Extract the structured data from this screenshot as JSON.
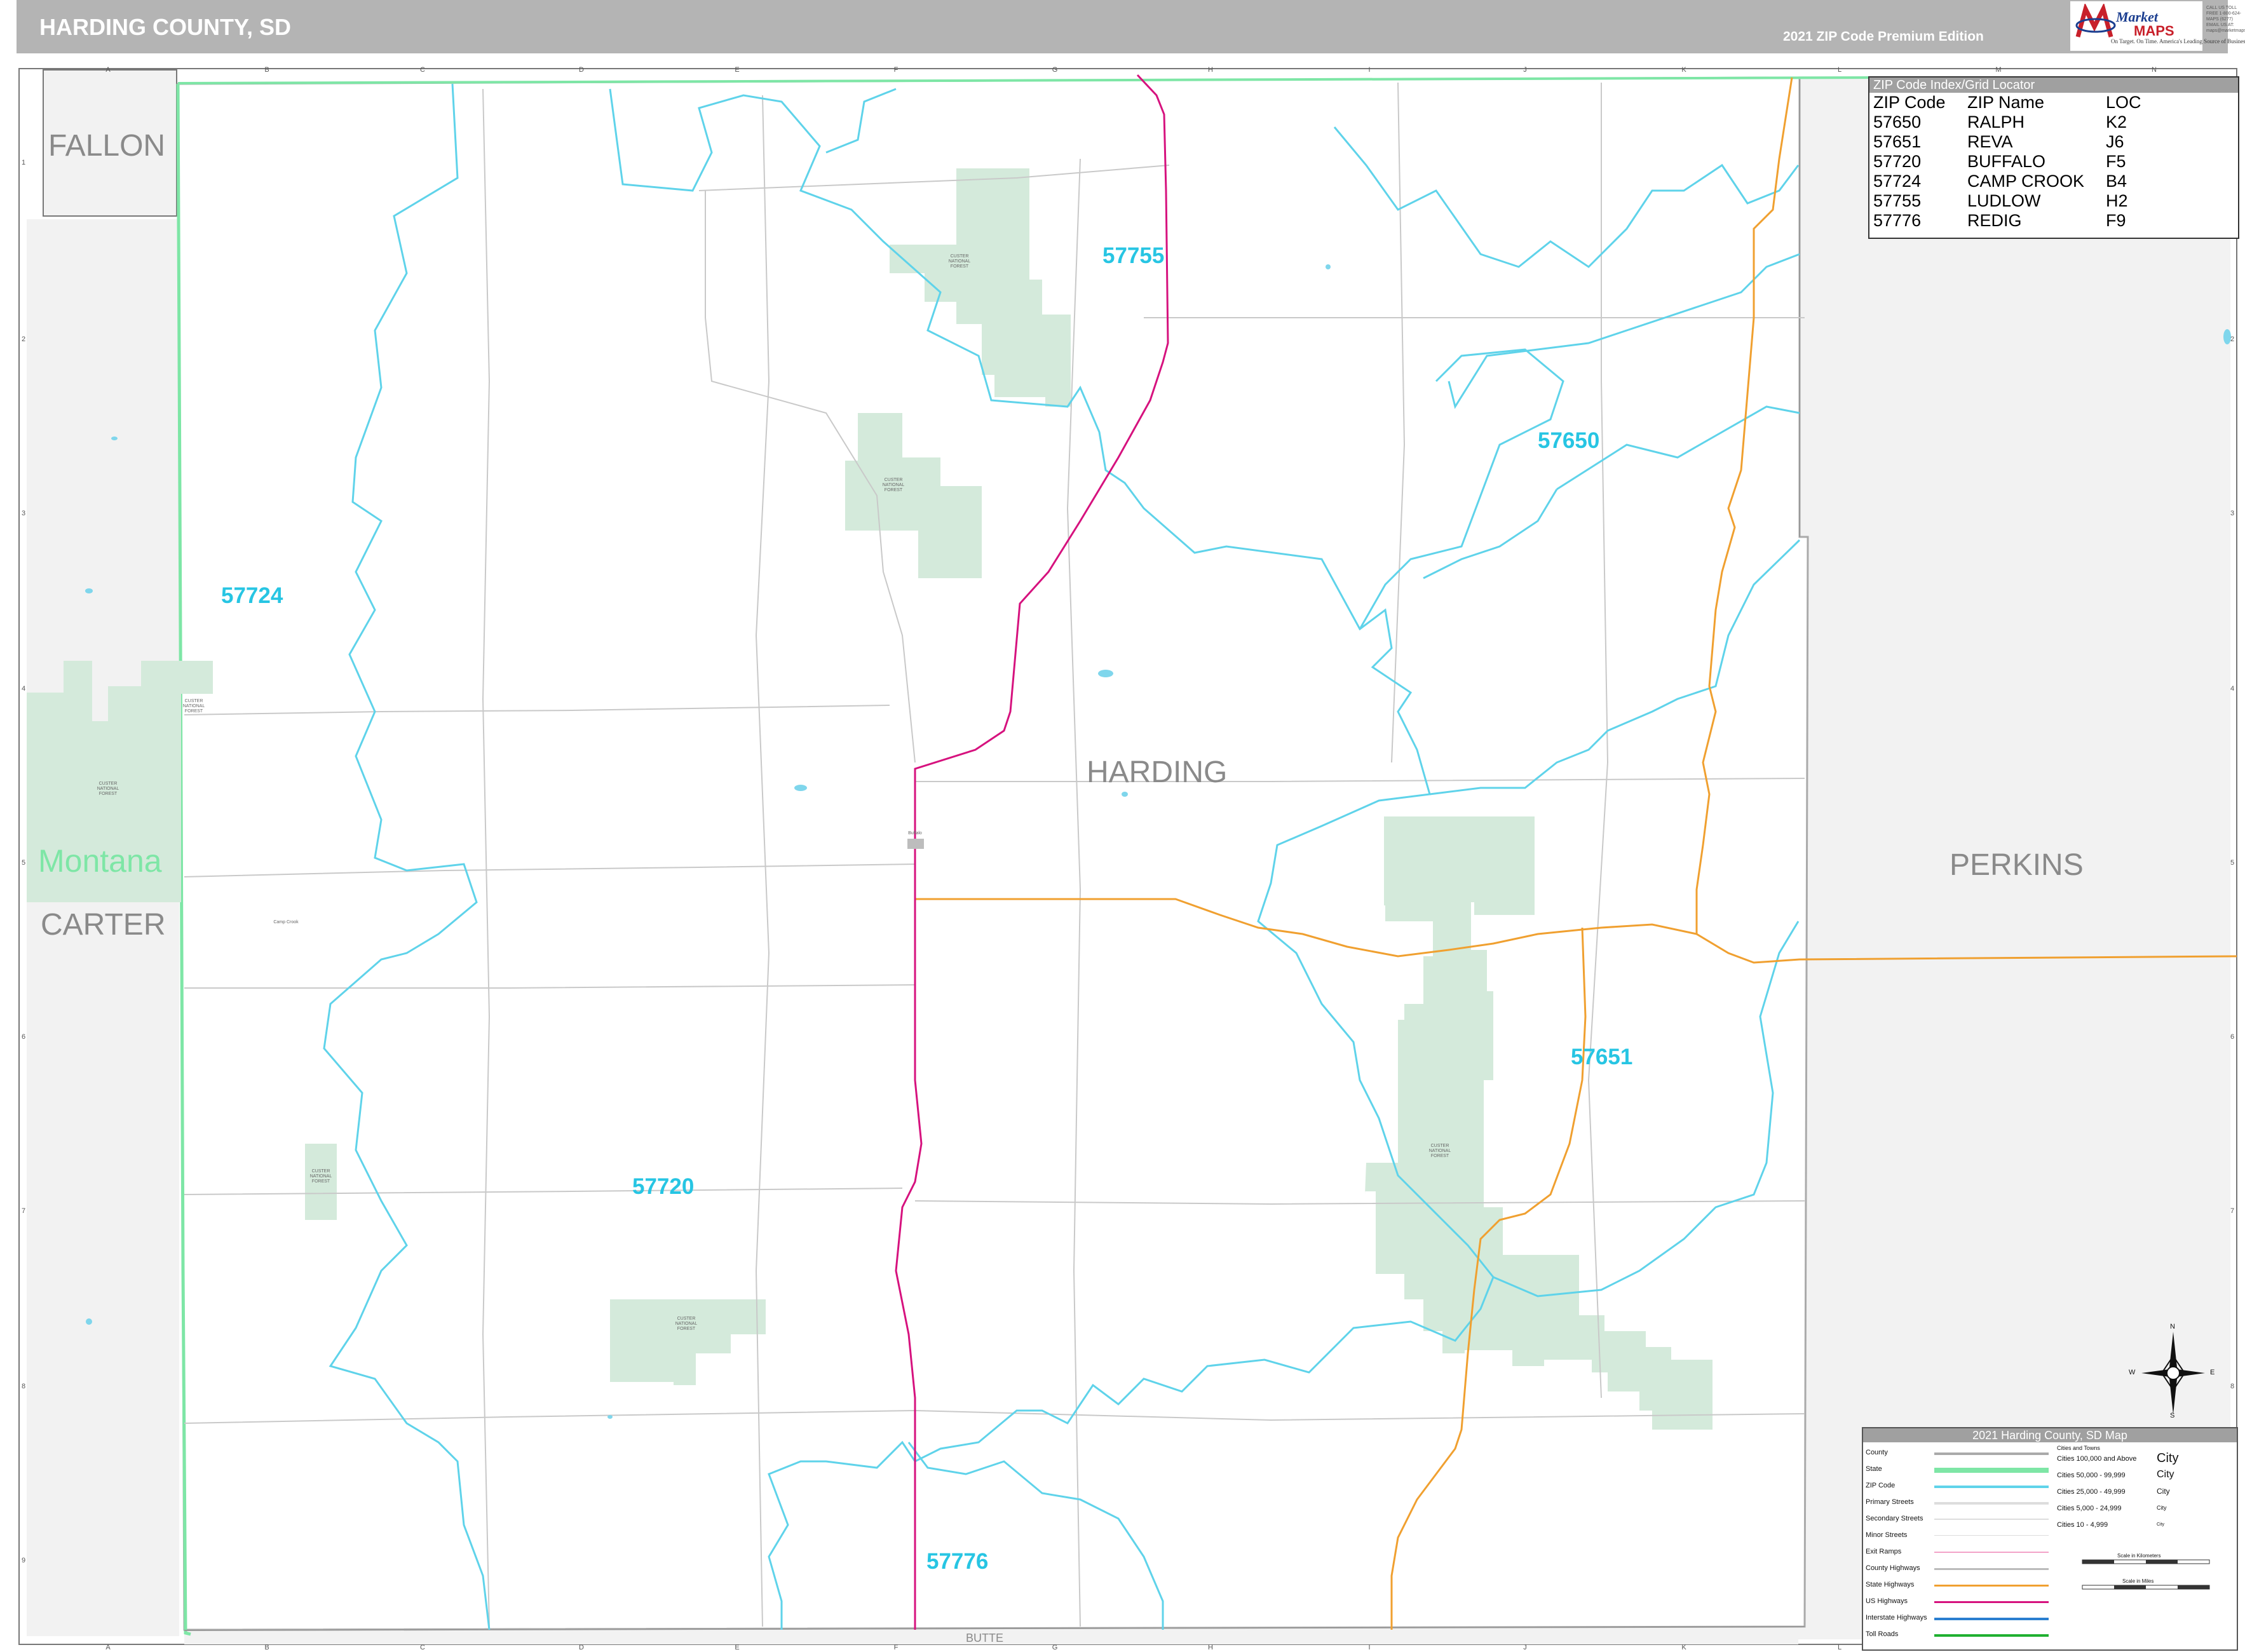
{
  "header": {
    "title": "HARDING COUNTY, SD",
    "edition": "2021 ZIP Code Premium Edition"
  },
  "brand": {
    "market": "Market",
    "maps": "MAPS",
    "slogan": "On Target. On Time. America's Leading Source of Business Maps",
    "contact": "CALL US TOLL FREE 1-800-624-MAPS (6277) EMAIL US AT: maps@marketmaps.com"
  },
  "regions": {
    "fallon": "FALLON",
    "carter": "CARTER",
    "perkins": "PERKINS",
    "butte": "BUTTE",
    "harding": "HARDING",
    "state": "Montana"
  },
  "zip_labels": [
    "57755",
    "57650",
    "57724",
    "57651",
    "57720",
    "57776"
  ],
  "small_places": {
    "forest": "CUSTER NATIONAL FOREST",
    "buffalo": "Buffalo",
    "camp_crook": "Camp Crook"
  },
  "zip_index": {
    "title": "ZIP Code Index/Grid Locator",
    "headers": [
      "ZIP Code",
      "ZIP Name",
      "LOC"
    ],
    "rows": [
      [
        "57650",
        "RALPH",
        "K2"
      ],
      [
        "57651",
        "REVA",
        "J6"
      ],
      [
        "57720",
        "BUFFALO",
        "F5"
      ],
      [
        "57724",
        "CAMP CROOK",
        "B4"
      ],
      [
        "57755",
        "LUDLOW",
        "H2"
      ],
      [
        "57776",
        "REDIG",
        "F9"
      ]
    ]
  },
  "legend": {
    "title": "2021 Harding County, SD Map",
    "items": [
      "County",
      "State",
      "ZIP Code",
      "Primary Streets",
      "Secondary Streets",
      "Minor Streets",
      "Exit Ramps",
      "County Highways",
      "State Highways",
      "US Highways",
      "Interstate Highways",
      "Toll Roads"
    ],
    "cities_header": "Cities and Towns",
    "cities": [
      {
        "range": "Cities 100,000 and Above",
        "example": "City"
      },
      {
        "range": "Cities 50,000 - 99,999",
        "example": "City"
      },
      {
        "range": "Cities 25,000 - 49,999",
        "example": "City"
      },
      {
        "range": "Cities 5,000 - 24,999",
        "example": "City"
      },
      {
        "range": "Cities 10 - 4,999",
        "example": "City"
      }
    ],
    "scale_km": "Scale in Kilometers",
    "scale_mi": "Scale in Miles"
  },
  "grid": {
    "letters": [
      "A",
      "B",
      "C",
      "D",
      "E",
      "F",
      "G",
      "H",
      "I",
      "J",
      "K",
      "L",
      "M",
      "N"
    ],
    "numbers": [
      "1",
      "2",
      "3",
      "4",
      "5",
      "6",
      "7",
      "8",
      "9"
    ]
  },
  "compass": {
    "n": "N",
    "s": "S",
    "e": "E",
    "w": "W"
  },
  "colors": {
    "zip_boundary": "#5fd3ea",
    "state_boundary": "#7ee6a6",
    "forest": "#d4eadb",
    "us_highway": "#d6127e",
    "state_highway": "#f0a030",
    "county_area": "#f2f2f2",
    "header_bg": "#b4b4b4"
  }
}
